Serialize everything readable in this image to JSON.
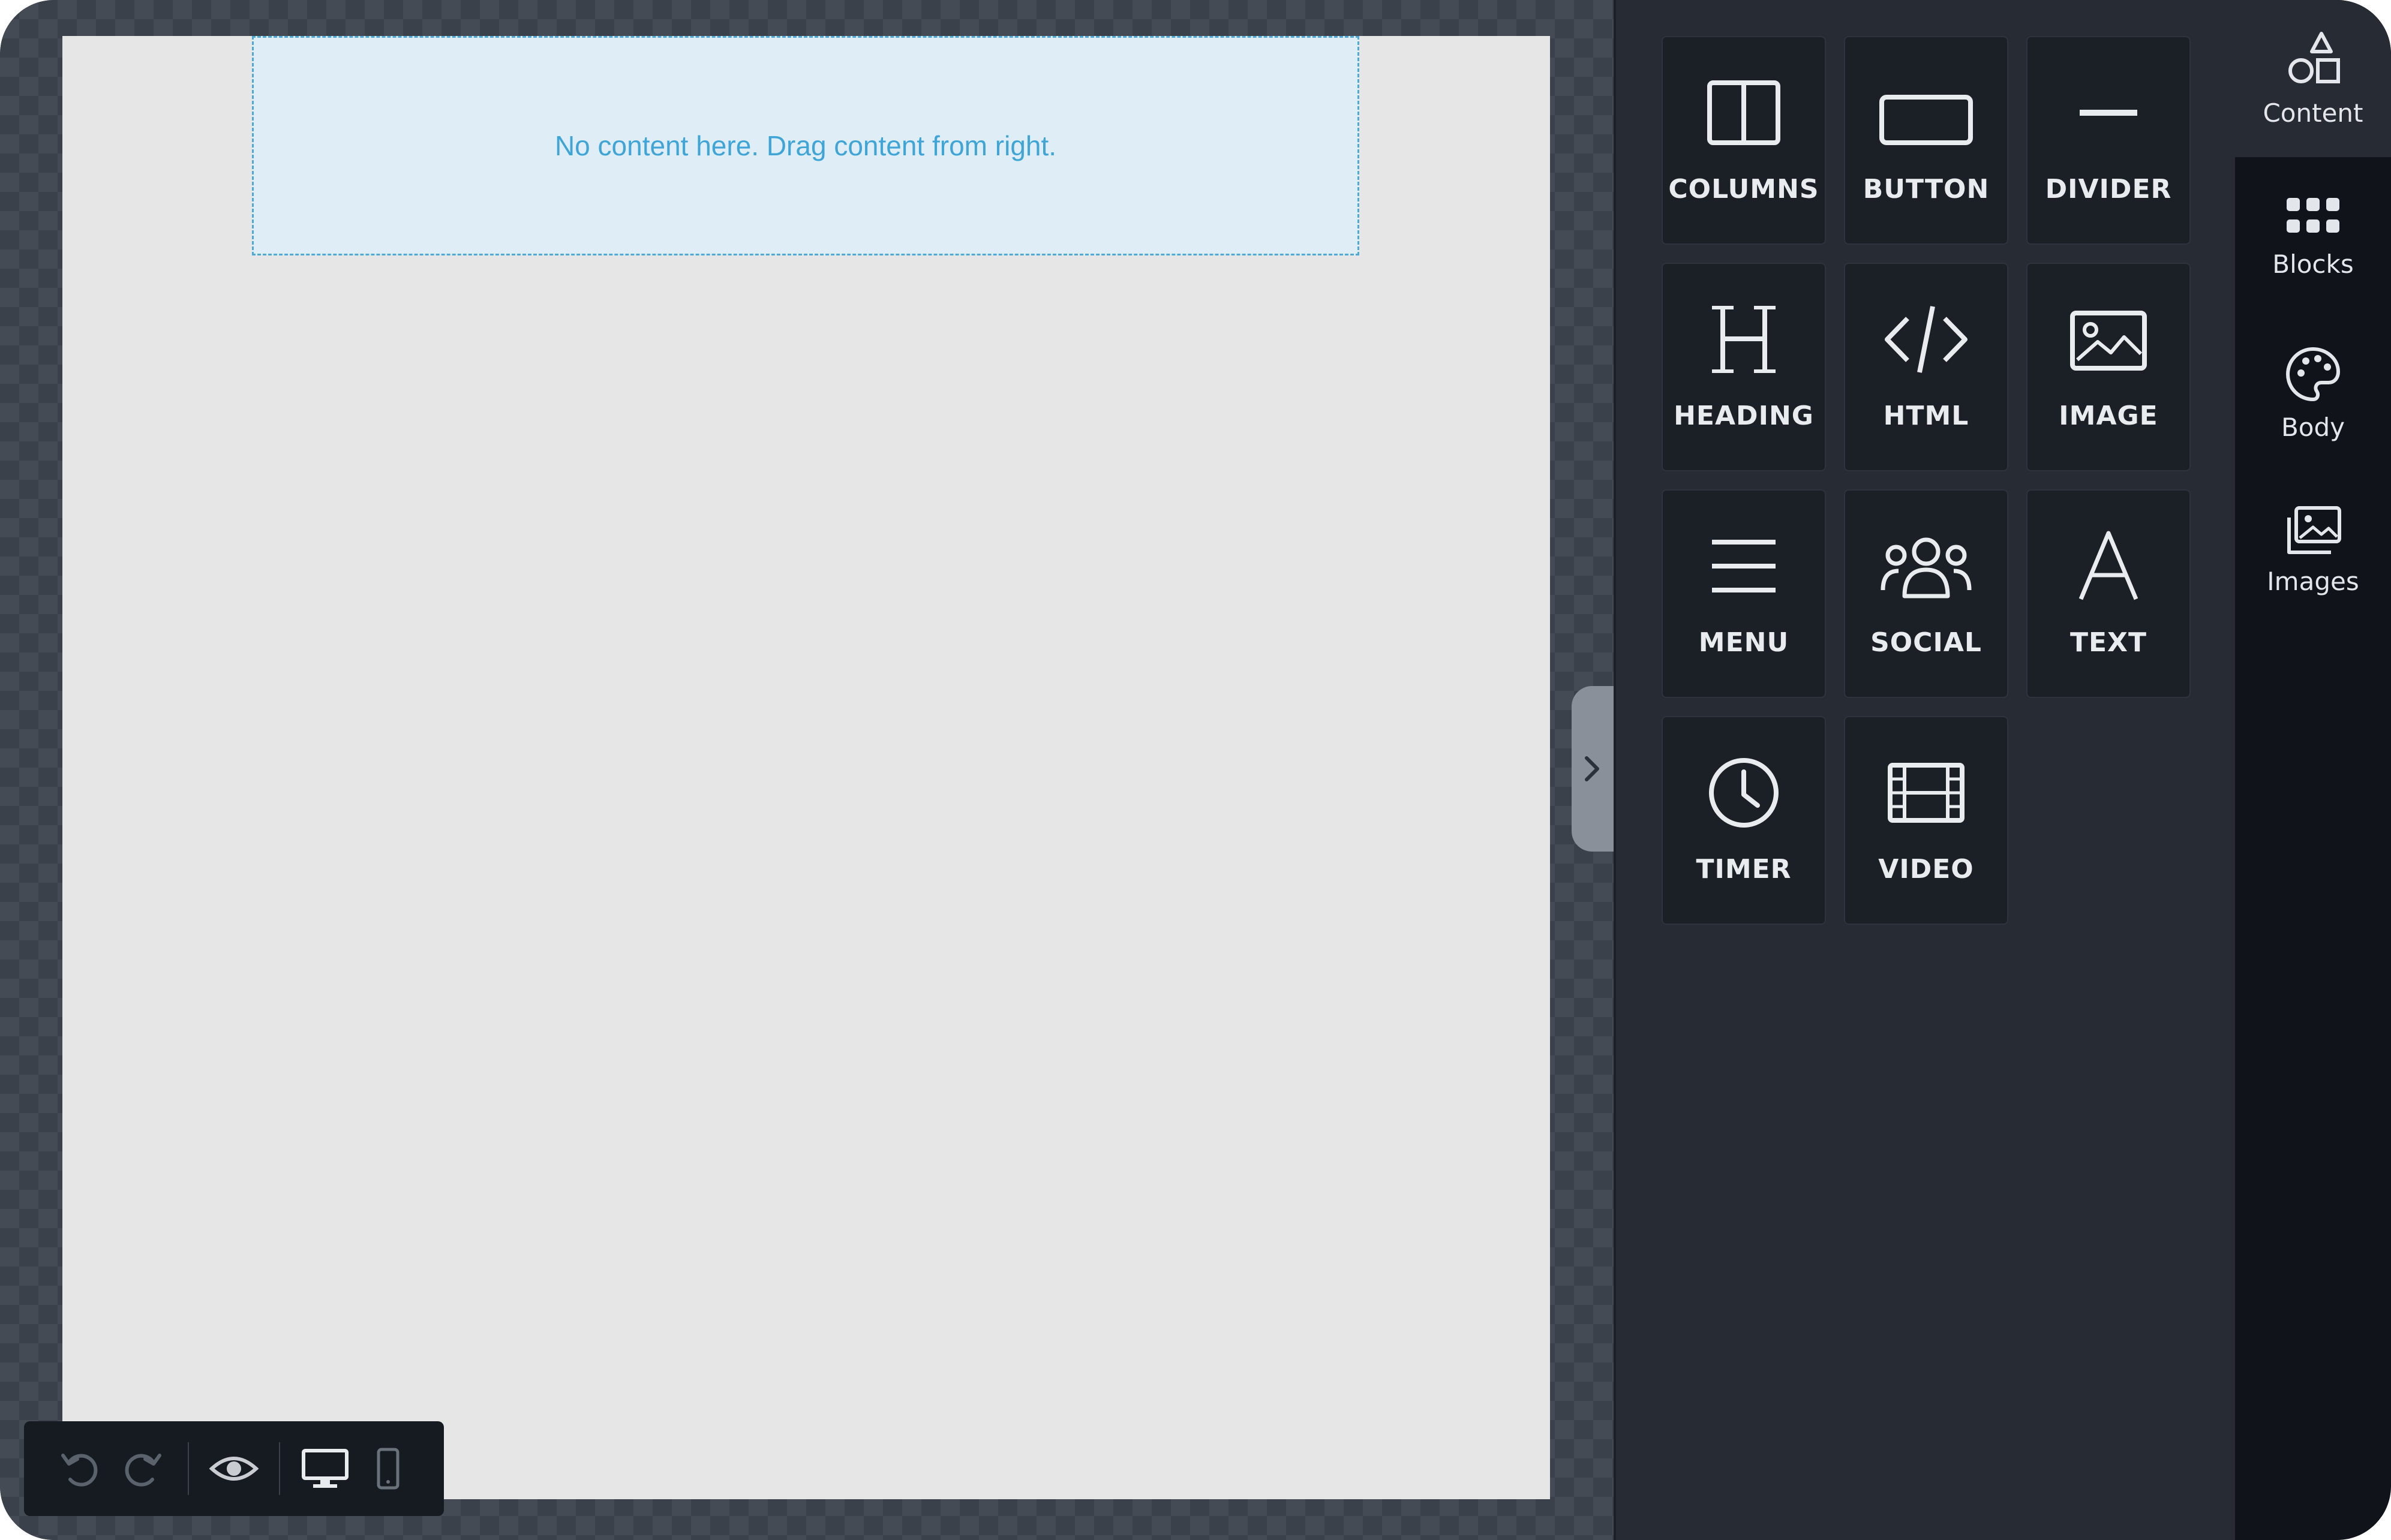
{
  "canvas": {
    "empty_message": "No content here. Drag content from right."
  },
  "tools": [
    {
      "label": "COLUMNS",
      "icon": "columns-icon"
    },
    {
      "label": "BUTTON",
      "icon": "button-icon"
    },
    {
      "label": "DIVIDER",
      "icon": "divider-icon"
    },
    {
      "label": "HEADING",
      "icon": "heading-icon"
    },
    {
      "label": "HTML",
      "icon": "code-icon"
    },
    {
      "label": "IMAGE",
      "icon": "image-icon"
    },
    {
      "label": "MENU",
      "icon": "menu-icon"
    },
    {
      "label": "SOCIAL",
      "icon": "social-icon"
    },
    {
      "label": "TEXT",
      "icon": "text-icon"
    },
    {
      "label": "TIMER",
      "icon": "clock-icon"
    },
    {
      "label": "VIDEO",
      "icon": "film-icon"
    }
  ],
  "nav": [
    {
      "label": "Content",
      "icon": "shapes-icon",
      "active": true
    },
    {
      "label": "Blocks",
      "icon": "grid-icon"
    },
    {
      "label": "Body",
      "icon": "palette-icon"
    },
    {
      "label": "Images",
      "icon": "images-icon"
    }
  ],
  "toolbar": {
    "buttons": [
      "undo-icon",
      "redo-icon",
      "eye-icon",
      "desktop-icon",
      "mobile-icon"
    ]
  },
  "colors": {
    "accent": "#3fa4d6",
    "panel_bg": "#262b34",
    "tile_bg": "#1b1f26",
    "nav_bg": "#10141a",
    "canvas_page": "#e6e6e6"
  }
}
